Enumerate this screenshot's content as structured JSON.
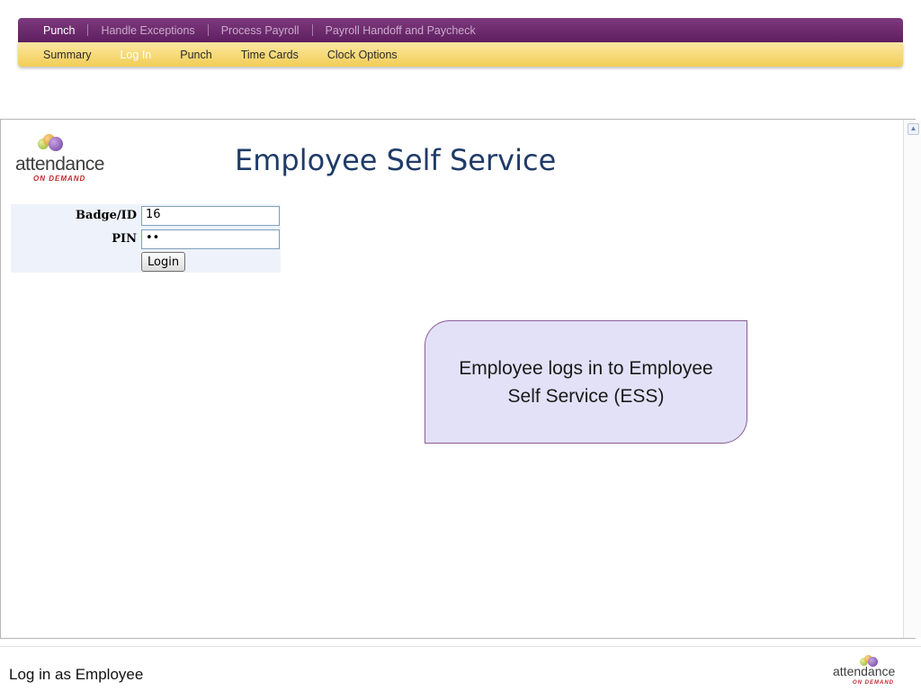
{
  "nav": {
    "primary": [
      {
        "label": "Punch",
        "active": true
      },
      {
        "label": "Handle Exceptions",
        "active": false
      },
      {
        "label": "Process Payroll",
        "active": false
      },
      {
        "label": "Payroll Handoff and Paycheck",
        "active": false
      }
    ],
    "secondary": [
      {
        "label": "Summary",
        "active": false
      },
      {
        "label": "Log In",
        "active": true
      },
      {
        "label": "Punch",
        "active": false
      },
      {
        "label": "Time Cards",
        "active": false
      },
      {
        "label": "Clock Options",
        "active": false
      }
    ]
  },
  "app": {
    "logo_word": "attendance",
    "logo_tag": "ON DEMAND",
    "title": "Employee Self Service"
  },
  "login": {
    "badge_label": "Badge/ID",
    "badge_value": "16",
    "pin_label": "PIN",
    "pin_value": "••",
    "button_label": "Login"
  },
  "callout": {
    "text": "Employee logs in to Employee Self Service (ESS)"
  },
  "footer": {
    "caption": "Log in as Employee",
    "logo_word": "attendance",
    "logo_tag": "ON DEMAND"
  },
  "icons": {
    "scroll_up": "scroll-up-arrow-icon",
    "logo_balls": "logo-balls-icon"
  },
  "colors": {
    "nav_primary": "#6b2a6c",
    "nav_secondary": "#f6d56e",
    "title": "#1f3b68",
    "callout_fill": "#e2e1f7",
    "callout_border": "#8e5a99"
  }
}
